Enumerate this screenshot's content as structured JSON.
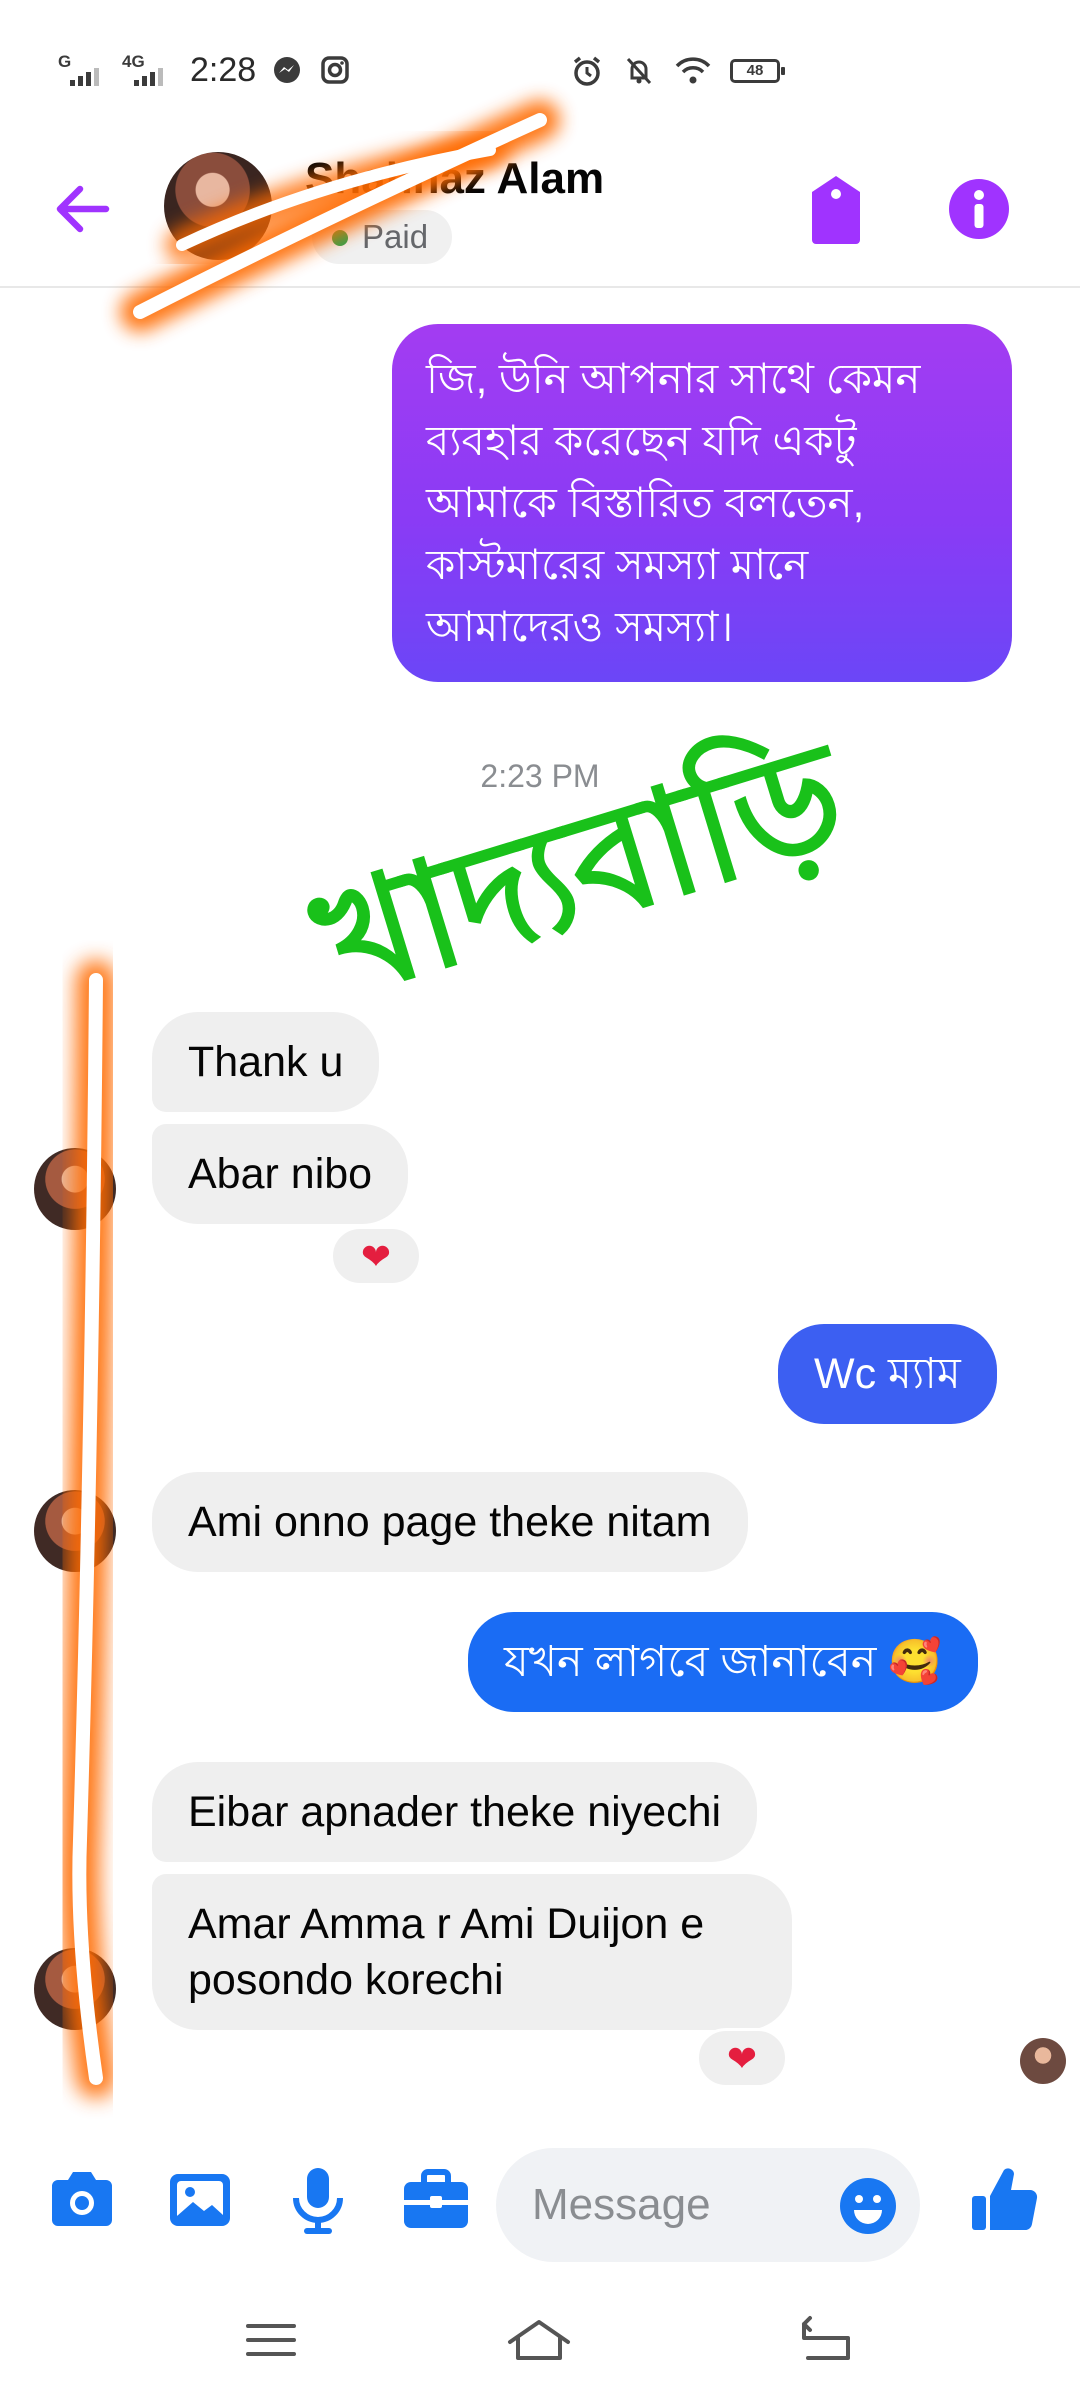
{
  "status_bar": {
    "time": "2:28",
    "network_1": "G",
    "network_2": "4G",
    "battery": "48"
  },
  "header": {
    "contact_name": "Shahnaz Alam",
    "badge": "Paid"
  },
  "conversation": {
    "outgoing_long": "জি, উনি আপনার সাথে কেমন ব্যবহার করেছেন যদি একটু আমাকে বিস্তারিত বলতেন, কাস্টমারের সমস্যা মানে আমাদেরও সমস্যা।",
    "timestamp": "2:23 PM",
    "watermark": "খাদ্যবাড়ি",
    "msg_thank_u": "Thank u",
    "msg_abar_nibo": "Abar nibo",
    "reaction_1": "❤",
    "msg_wc": "Wc ম্যাম",
    "msg_ami_onno": "Ami onno page theke nitam",
    "msg_jokhon": "যখন লাগবে জানাবেন 🥰",
    "msg_eibar": "Eibar apnader theke niyechi",
    "msg_amar_amma": "Amar Amma r Ami Duijon e posondo korechi",
    "reaction_2": "❤"
  },
  "composer": {
    "placeholder": "Message"
  },
  "colors": {
    "accent": "#a033ff",
    "blue_bubble": "#1a6cf4",
    "composer_icon": "#1877f2",
    "watermark": "#19c11a",
    "scribble": "#ff7a1a"
  }
}
